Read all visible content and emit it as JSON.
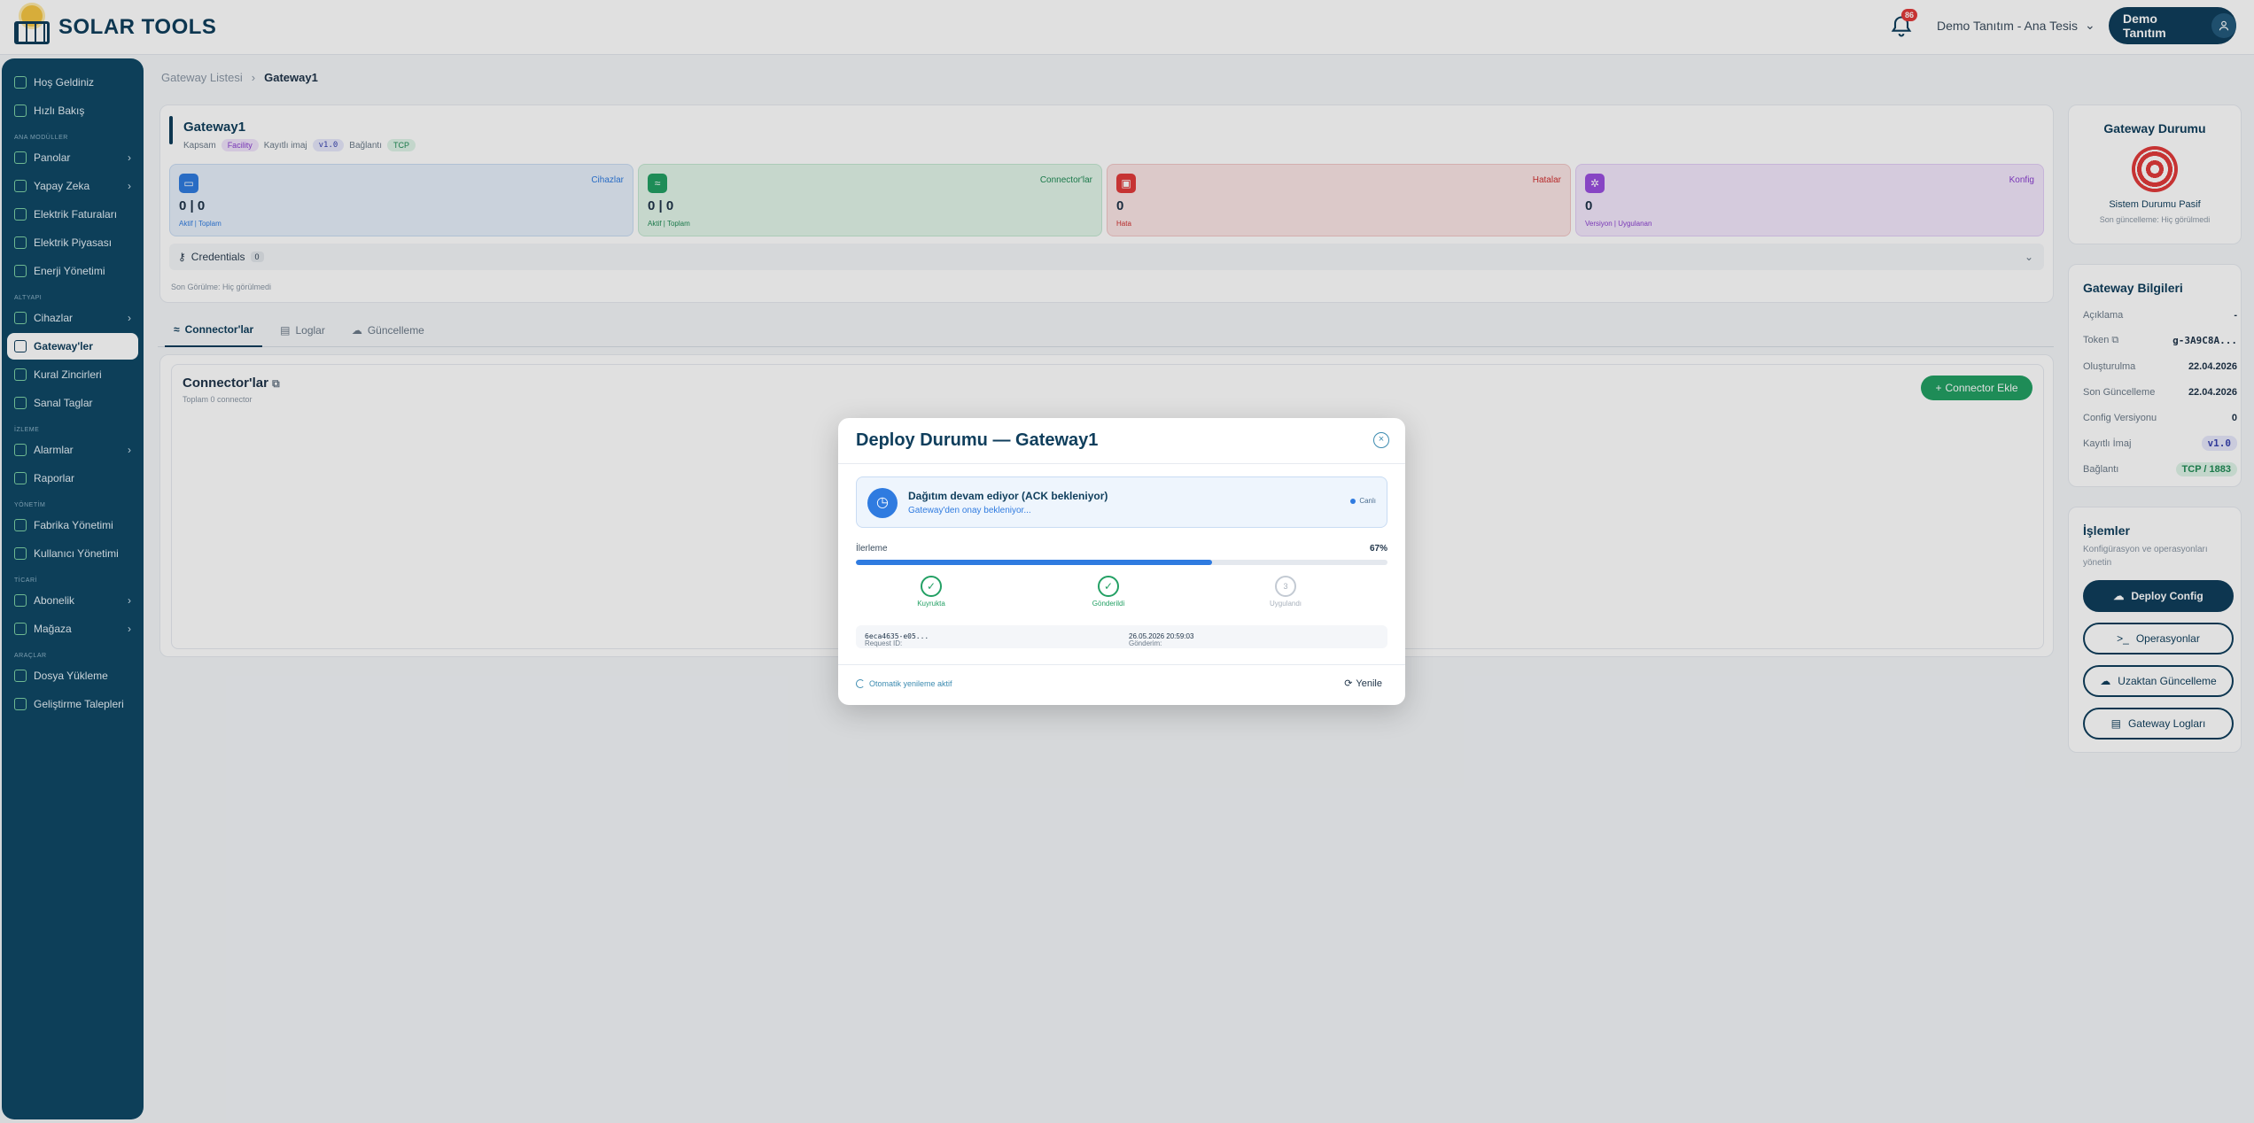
{
  "header": {
    "brand": "SOLAR TOOLS",
    "notification_count": "86",
    "tenant": "Demo Tanıtım - Ana Tesis",
    "user": "Demo Tanıtım"
  },
  "sidebar": {
    "top": [
      {
        "label": "Hoş Geldiniz"
      },
      {
        "label": "Hızlı Bakış"
      }
    ],
    "sections": [
      {
        "title": "ANA MODÜLLER",
        "items": [
          {
            "label": "Panolar",
            "chevron": true
          },
          {
            "label": "Yapay Zeka",
            "chevron": true
          },
          {
            "label": "Elektrik Faturaları"
          },
          {
            "label": "Elektrik Piyasası"
          },
          {
            "label": "Enerji Yönetimi"
          }
        ]
      },
      {
        "title": "ALTYAPI",
        "items": [
          {
            "label": "Cihazlar",
            "chevron": true
          },
          {
            "label": "Gateway'ler",
            "active": true
          },
          {
            "label": "Kural Zincirleri"
          },
          {
            "label": "Sanal Taglar"
          }
        ]
      },
      {
        "title": "İZLEME",
        "items": [
          {
            "label": "Alarmlar",
            "chevron": true
          },
          {
            "label": "Raporlar"
          }
        ]
      },
      {
        "title": "YÖNETİM",
        "items": [
          {
            "label": "Fabrika Yönetimi"
          },
          {
            "label": "Kullanıcı Yönetimi"
          }
        ]
      },
      {
        "title": "TİCARİ",
        "items": [
          {
            "label": "Abonelik",
            "chevron": true
          },
          {
            "label": "Mağaza",
            "chevron": true
          }
        ]
      },
      {
        "title": "ARAÇLAR",
        "items": [
          {
            "label": "Dosya Yükleme"
          },
          {
            "label": "Geliştirme Talepleri"
          }
        ]
      }
    ]
  },
  "breadcrumb": {
    "parent": "Gateway Listesi",
    "current": "Gateway1"
  },
  "gateway": {
    "name": "Gateway1",
    "scope_label": "Kapsam",
    "scope_value": "Facility",
    "image_label": "Kayıtlı imaj",
    "image_value": "v1.0",
    "conn_label": "Bağlantı",
    "conn_value": "TCP",
    "stats": [
      {
        "label": "Cihazlar",
        "value": "0 | 0",
        "sub": "Aktif | Toplam",
        "icon": "monitor-icon",
        "color": "#2f7be0"
      },
      {
        "label": "Connector'lar",
        "value": "0 | 0",
        "sub": "Aktif | Toplam",
        "icon": "wifi-icon",
        "color": "#23a064"
      },
      {
        "label": "Hatalar",
        "value": "0",
        "sub": "Hata",
        "icon": "lock-icon",
        "color": "#e23b3b"
      },
      {
        "label": "Konfig",
        "value": "0",
        "sub": "Versiyon | Uygulanan",
        "icon": "gear-icon",
        "color": "#9a4fe0"
      }
    ],
    "credentials_label": "Credentials",
    "credentials_count": "0",
    "last_seen": "Son Görülme: Hiç görülmedi"
  },
  "tabs": [
    {
      "label": "Connector'lar",
      "active": true
    },
    {
      "label": "Loglar"
    },
    {
      "label": "Güncelleme"
    }
  ],
  "connectors": {
    "title": "Connector'lar",
    "subtitle": "Toplam 0 connector",
    "add_label": "Connector Ekle"
  },
  "status_card": {
    "title": "Gateway Durumu",
    "state": "Sistem Durumu Pasif",
    "last_update": "Son güncelleme: Hiç görülmedi"
  },
  "info_card": {
    "title": "Gateway Bilgileri",
    "rows": [
      {
        "label": "Açıklama",
        "value": "-"
      },
      {
        "label": "Token",
        "value": "g-3A9C8A..."
      },
      {
        "label": "Oluşturulma",
        "value": "22.04.2026"
      },
      {
        "label": "Son Güncelleme",
        "value": "22.04.2026"
      },
      {
        "label": "Config Versiyonu",
        "value": "0"
      },
      {
        "label": "Kayıtlı İmaj",
        "value": "v1.0"
      },
      {
        "label": "Bağlantı",
        "value": "TCP / 1883"
      }
    ]
  },
  "ops_card": {
    "title": "İşlemler",
    "subtitle": "Konfigürasyon ve operasyonları yönetin",
    "buttons": [
      "Deploy Config",
      "Operasyonlar",
      "Uzaktan Güncelleme",
      "Gateway Logları"
    ]
  },
  "modal": {
    "title": "Deploy Durumu — Gateway1",
    "status_title": "Dağıtım devam ediyor (ACK bekleniyor)",
    "status_sub": "Gateway'den onay bekleniyor...",
    "live_label": "Canlı",
    "progress_label": "İlerleme",
    "progress_pct": "67%",
    "progress_value": 0.67,
    "steps": [
      {
        "label": "Kuyrukta",
        "done": true,
        "glyph": "✓"
      },
      {
        "label": "Gönderildi",
        "done": true,
        "glyph": "✓"
      },
      {
        "label": "Uygulandı",
        "done": false,
        "glyph": "3"
      }
    ],
    "request_label": "Request ID:",
    "request_id": "6eca4635-e05...",
    "sent_label": "Gönderim:",
    "sent_at": "26.05.2026 20:59:03",
    "auto_refresh": "Otomatik yenileme aktif",
    "refresh_label": "Yenile"
  }
}
